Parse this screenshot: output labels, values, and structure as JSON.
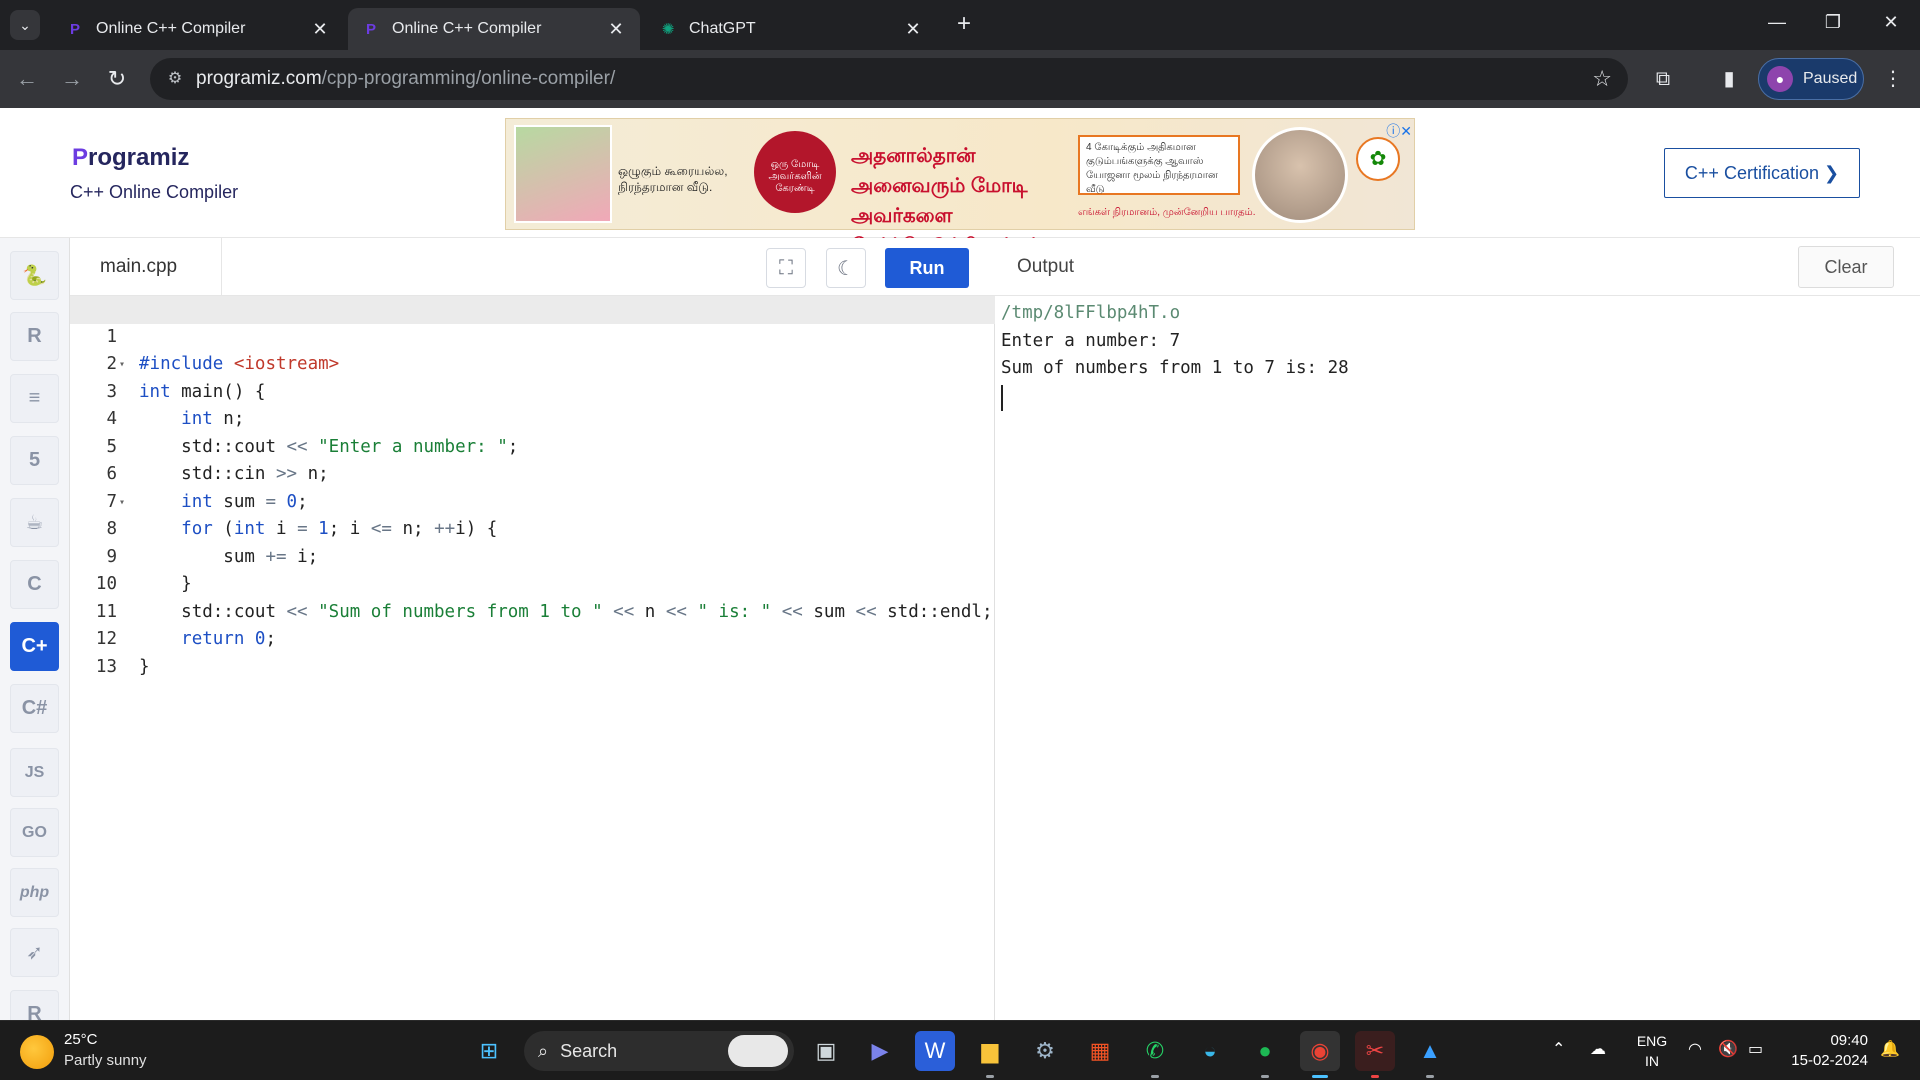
{
  "browser": {
    "tabs": [
      {
        "title": "Online C++ Compiler",
        "active": false,
        "favicon": "programiz-icon"
      },
      {
        "title": "Online C++ Compiler",
        "active": true,
        "favicon": "programiz-icon"
      },
      {
        "title": "ChatGPT",
        "active": false,
        "favicon": "chatgpt-icon"
      }
    ],
    "url_domain": "programiz.com",
    "url_path": "/cpp-programming/online-compiler/",
    "profile_label": "Paused"
  },
  "site": {
    "logo_text": "rogramiz",
    "logo_p": "P",
    "subtitle": "C++ Online Compiler",
    "certification_label": "C++ Certification ❯"
  },
  "ad": {
    "text1": "ஒழுகும் கூரையல்ல, நிரந்தரமான வீடு.",
    "seal": "ஒரு மோடி அவர்களின் கேரண்டி",
    "headline": "அதனால்தான் அனைவரும் மோடி அவர்களை தேர்ந்தெடுக்கிறார்கள்",
    "box": "4 கோடிக்கும் அதிகமான குடும்பங்களுக்கு ஆவாஸ் யோஜனா மூலம் நிரந்தரமான வீடு",
    "tagline": "எங்கள் நிரமானம், முன்னேறிய பாரதம்."
  },
  "languages": [
    {
      "name": "python-icon",
      "label": "🐍"
    },
    {
      "name": "r-icon",
      "label": "R"
    },
    {
      "name": "sql-icon",
      "label": "≡"
    },
    {
      "name": "html-icon",
      "label": "5"
    },
    {
      "name": "java-icon",
      "label": "☕"
    },
    {
      "name": "c-icon",
      "label": "C"
    },
    {
      "name": "cpp-icon",
      "label": "C+"
    },
    {
      "name": "csharp-icon",
      "label": "C#"
    },
    {
      "name": "js-icon",
      "label": "JS"
    },
    {
      "name": "go-icon",
      "label": "GO"
    },
    {
      "name": "php-icon",
      "label": "php"
    },
    {
      "name": "swift-icon",
      "label": "➶"
    },
    {
      "name": "rust-icon",
      "label": "R"
    }
  ],
  "editor": {
    "filename": "main.cpp",
    "run_label": "Run",
    "lines": [
      {
        "n": "1"
      },
      {
        "n": "2"
      },
      {
        "n": "3"
      },
      {
        "n": "4"
      },
      {
        "n": "5"
      },
      {
        "n": "6"
      },
      {
        "n": "7"
      },
      {
        "n": "8"
      },
      {
        "n": "9"
      },
      {
        "n": "10"
      },
      {
        "n": "11"
      },
      {
        "n": "12"
      },
      {
        "n": "13"
      }
    ],
    "code": {
      "l1_inc": "#include",
      "l1_hdr": "<iostream>",
      "l2_kw": "int",
      "l2_rest": " main() {",
      "l3_kw": "int",
      "l3_rest": " n;",
      "l4_a": "std::cout ",
      "l4_op": "<<",
      "l4_str": " \"Enter a number: \"",
      "l4_end": ";",
      "l5_a": "std::cin ",
      "l5_op": ">>",
      "l5_b": " n;",
      "l6_kw": "int",
      "l6_a": " sum ",
      "l6_op": "=",
      "l6_num": " 0",
      "l6_end": ";",
      "l7_kw1": "for",
      "l7_a": " (",
      "l7_kw2": "int",
      "l7_b": " i ",
      "l7_op1": "=",
      "l7_num": " 1",
      "l7_c": "; i ",
      "l7_op2": "<=",
      "l7_d": " n; ",
      "l7_op3": "++",
      "l7_e": "i) {",
      "l8_a": "sum ",
      "l8_op": "+=",
      "l8_b": " i;",
      "l9": "}",
      "l10_a": "std::cout ",
      "l10_op1": "<<",
      "l10_str1": " \"Sum of numbers from 1 to \"",
      "l10_b": " ",
      "l10_op2": "<<",
      "l10_c": " n ",
      "l10_op3": "<<",
      "l10_str2": " \" is: \"",
      "l10_d": " ",
      "l10_op4": "<<",
      "l10_e": " sum ",
      "l10_op5": "<<",
      "l10_f": " std::endl;",
      "l11_kw": "return",
      "l11_num": " 0",
      "l11_end": ";",
      "l12": "}"
    }
  },
  "output": {
    "title": "Output",
    "clear_label": "Clear",
    "lines": [
      "/tmp/8lFFlbp4hT.o",
      "Enter a number: 7",
      "Sum of numbers from 1 to 7 is: 28"
    ]
  },
  "taskbar": {
    "temperature": "25°C",
    "condition": "Partly sunny",
    "search_label": "Search",
    "lang_top": "ENG",
    "lang_bottom": "IN",
    "time": "09:40",
    "date": "15-02-2024"
  }
}
